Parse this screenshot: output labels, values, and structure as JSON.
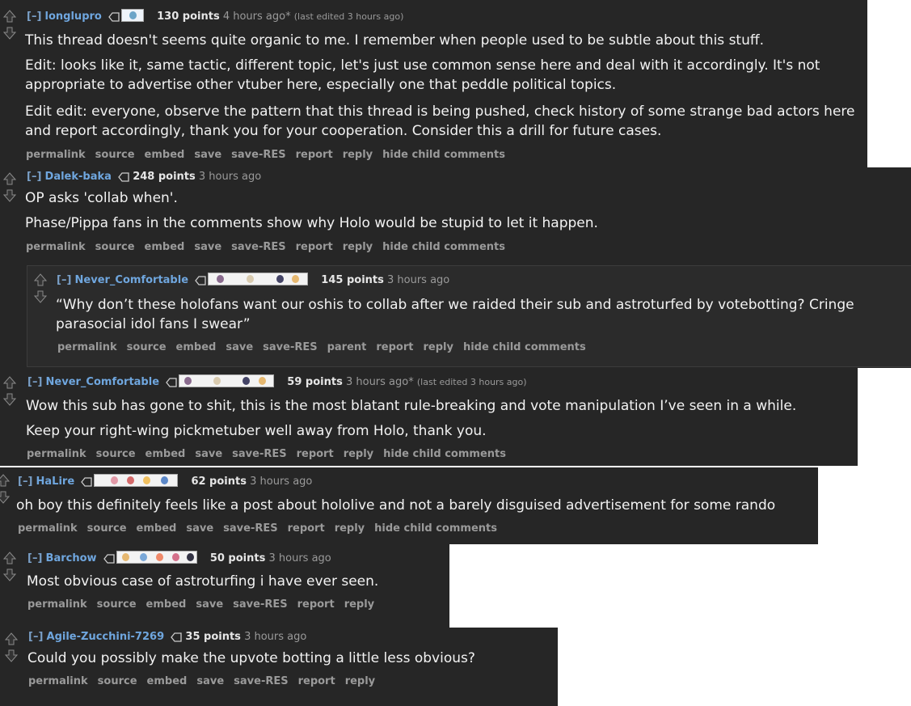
{
  "comments": [
    {
      "toggle": "[–]",
      "user": "longlupro",
      "points": "130 points",
      "time": "4 hours ago*",
      "edited": "(last edited 3 hours ago)",
      "body": [
        "This thread doesn't seems quite organic to me. I remember when people used to be subtle about this stuff.",
        "Edit: looks like it, same tactic, different topic, let's just use common sense here and deal with it accordingly. It's not appropriate to advertise other vtuber here, especially one that peddle political topics.",
        "Edit edit: everyone, observe the pattern that this thread is being pushed, check history of some strange bad actors here and report accordingly, thank you for your cooperation. Consider this a drill for future cases."
      ],
      "buttons": [
        "permalink",
        "source",
        "embed",
        "save",
        "save-RES",
        "report",
        "reply",
        "hide child comments"
      ]
    },
    {
      "toggle": "[–]",
      "user": "Dalek-baka",
      "points": "248 points",
      "time": "3 hours ago",
      "edited": "",
      "body": [
        "OP asks 'collab when'.",
        "Phase/Pippa fans in the comments show why Holo would be stupid to let it happen."
      ],
      "buttons": [
        "permalink",
        "source",
        "embed",
        "save",
        "save-RES",
        "report",
        "reply",
        "hide child comments"
      ]
    },
    {
      "toggle": "[–]",
      "user": "Never_Comfortable",
      "points": "145 points",
      "time": "3 hours ago",
      "edited": "",
      "body": [
        "“Why don’t these holofans want our oshis to collab after we raided their sub and astroturfed by votebotting? Cringe parasocial idol fans I swear”"
      ],
      "buttons": [
        "permalink",
        "source",
        "embed",
        "save",
        "save-RES",
        "parent",
        "report",
        "reply",
        "hide child comments"
      ]
    },
    {
      "toggle": "[–]",
      "user": "Never_Comfortable",
      "points": "59 points",
      "time": "3 hours ago*",
      "edited": "(last edited 3 hours ago)",
      "body": [
        "Wow this sub has gone to shit, this is the most blatant rule-breaking and vote manipulation I’ve seen in a while.",
        "Keep your right-wing pickmetuber well away from Holo, thank you."
      ],
      "buttons": [
        "permalink",
        "source",
        "embed",
        "save",
        "save-RES",
        "report",
        "reply",
        "hide child comments"
      ]
    },
    {
      "toggle": "[–]",
      "user": "HaLire",
      "points": "62 points",
      "time": "3 hours ago",
      "edited": "",
      "body": [
        "oh boy this definitely feels like a post about hololive and not a barely disguised advertisement for some rando"
      ],
      "buttons": [
        "permalink",
        "source",
        "embed",
        "save",
        "save-RES",
        "report",
        "reply",
        "hide child comments"
      ]
    },
    {
      "toggle": "[–]",
      "user": "Barchow",
      "points": "50 points",
      "time": "3 hours ago",
      "edited": "",
      "body": [
        "Most obvious case of astroturfing i have ever seen."
      ],
      "buttons": [
        "permalink",
        "source",
        "embed",
        "save",
        "save-RES",
        "report",
        "reply"
      ]
    },
    {
      "toggle": "[–]",
      "user": "Agile-Zucchini-7269",
      "points": "35 points",
      "time": "3 hours ago",
      "edited": "",
      "body": [
        "Could you possibly make the upvote botting a little less obvious?"
      ],
      "buttons": [
        "permalink",
        "source",
        "embed",
        "save",
        "save-RES",
        "report",
        "reply"
      ]
    }
  ],
  "icons": {
    "upvote": "upvote-arrow-icon",
    "downvote": "downvote-arrow-icon",
    "flair": "flair-tag-icon"
  },
  "colors": {
    "background": "#262626",
    "username": "#6fa6de",
    "text": "#f2f2f2",
    "muted": "#9a9a9a"
  }
}
